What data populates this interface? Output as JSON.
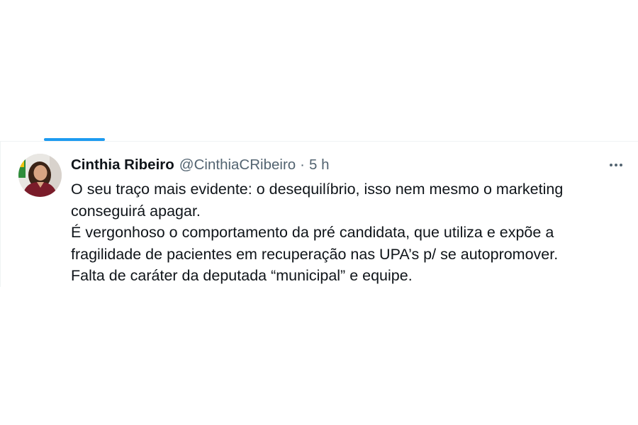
{
  "tweet": {
    "display_name": "Cinthia Ribeiro",
    "handle": "@CinthiaCRibeiro",
    "separator": "·",
    "timestamp": "5 h",
    "text_lines": [
      "O seu traço mais evidente: o desequilíbrio, isso nem mesmo o marketing",
      "conseguirá apagar.",
      "É vergonhoso o comportamento da pré candidata, que utiliza e expõe a",
      "fragilidade de pacientes em recuperação nas UPA’s p/ se autopromover.",
      "Falta de caráter da deputada “municipal” e equipe."
    ],
    "more_icon": "more-horizontal-icon"
  },
  "colors": {
    "accent": "#1d9bf0",
    "text_primary": "#0f1419",
    "text_secondary": "#536471",
    "divider": "#eff3f4"
  }
}
